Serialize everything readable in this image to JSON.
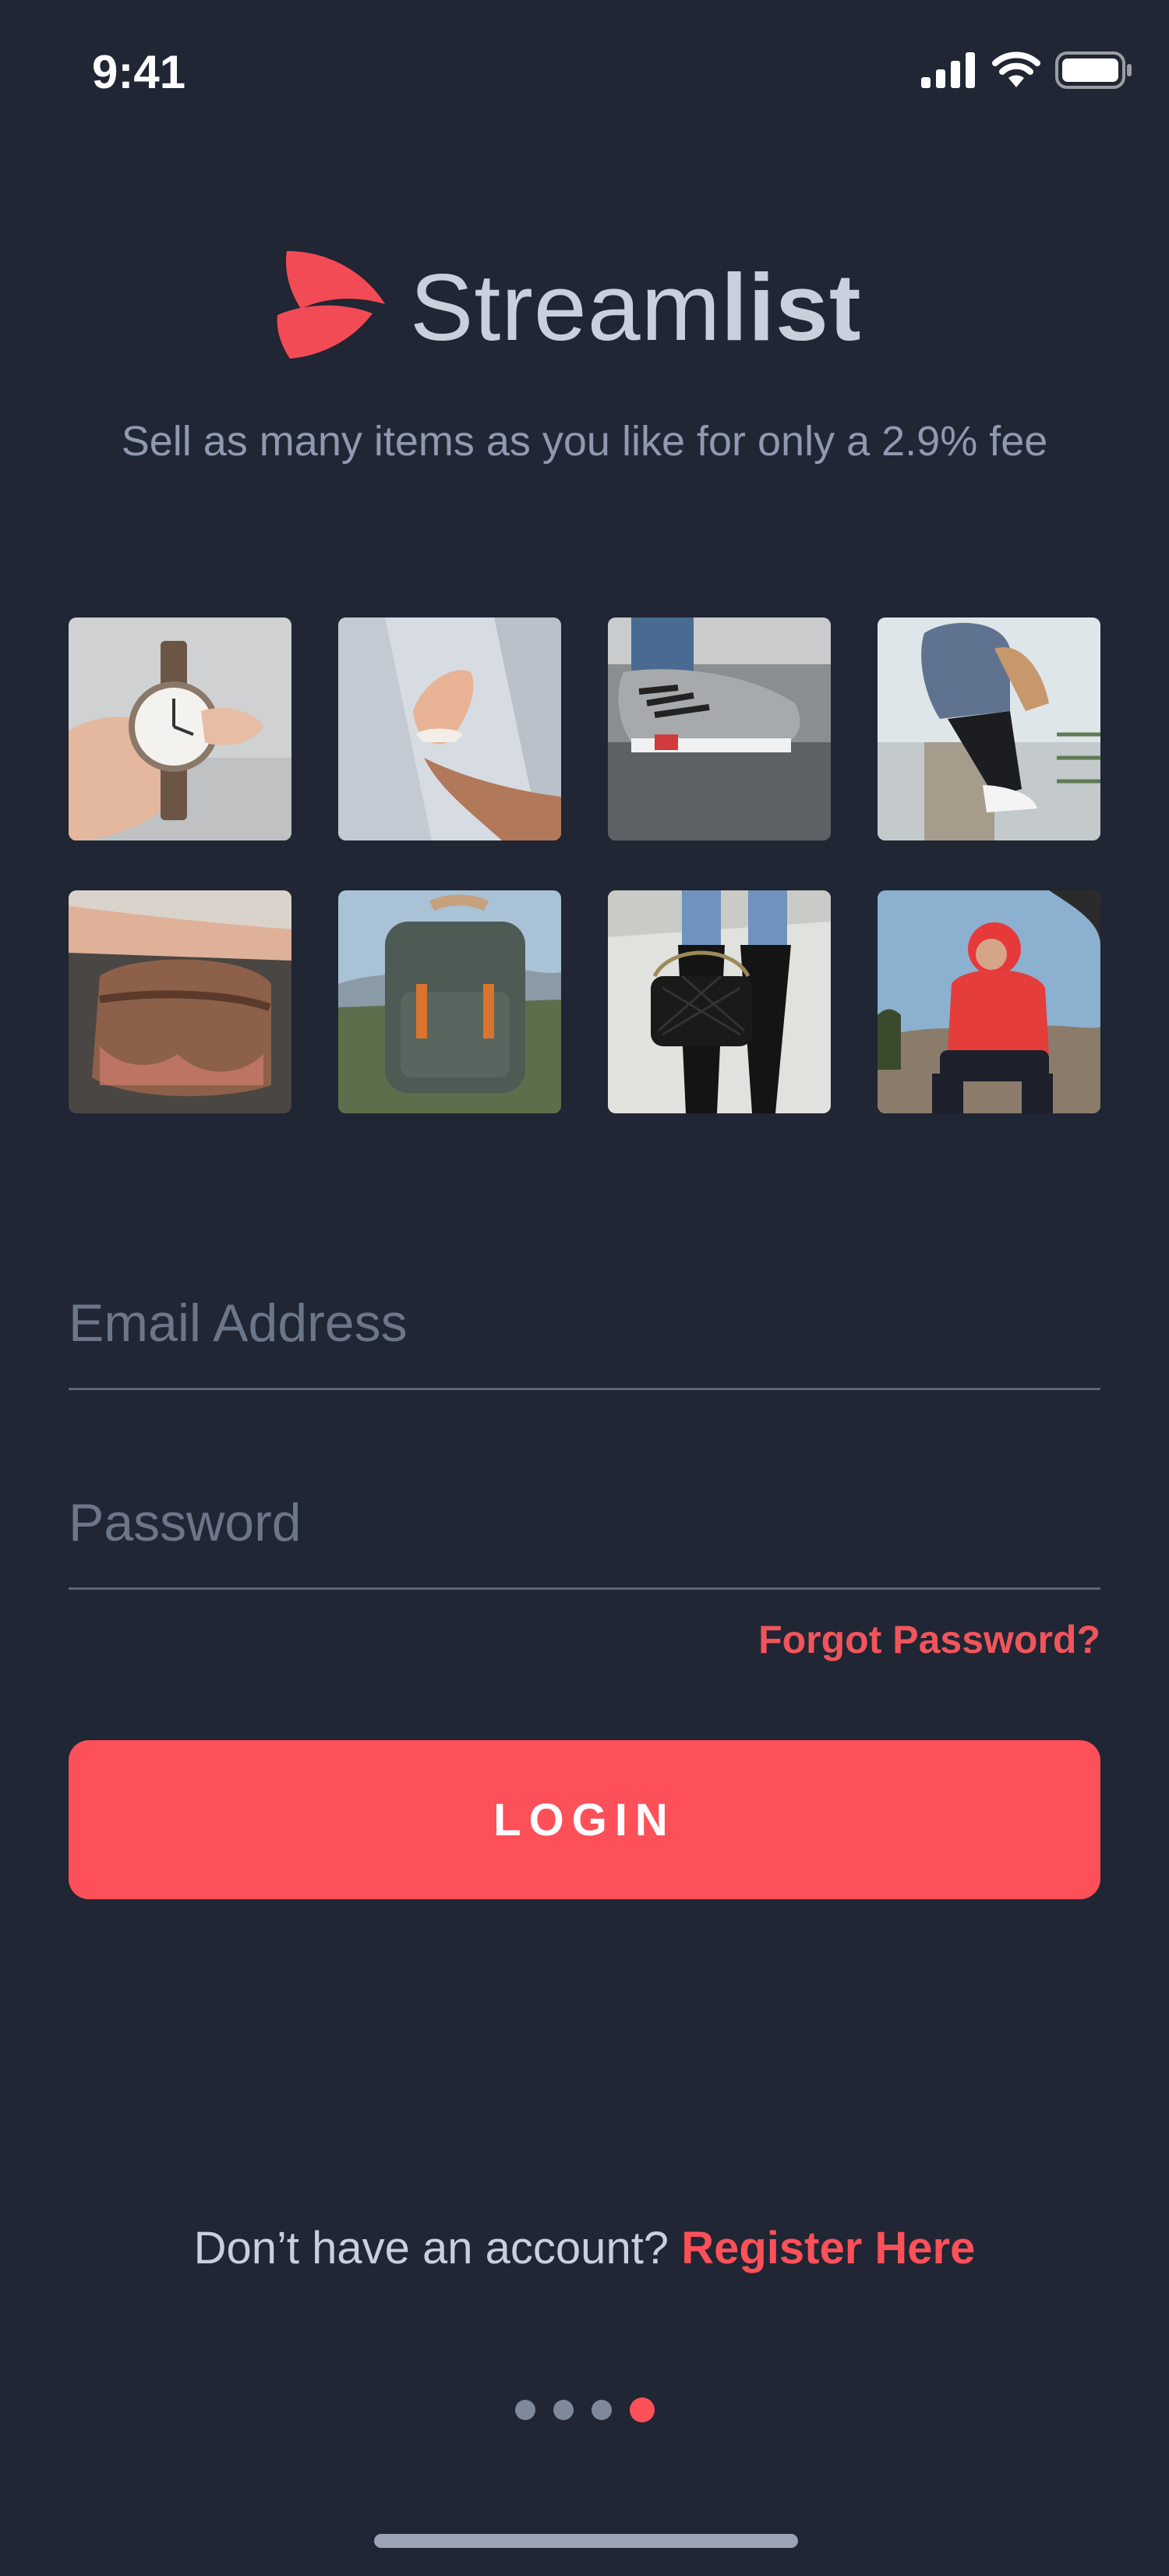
{
  "status_bar": {
    "time": "9:41",
    "icons": [
      "cellular-signal-icon",
      "wifi-icon",
      "battery-icon"
    ]
  },
  "brand": {
    "name_light": "Stream",
    "name_bold": "list",
    "logo_icon": "streamlist-logo-icon",
    "accent_color": "#fd5059"
  },
  "tagline": "Sell as many items as you like for only a 2.9% fee",
  "gallery": {
    "items": [
      {
        "name": "wristwatch-photo"
      },
      {
        "name": "sneaker-hand-photo"
      },
      {
        "name": "grey-sneakers-photo"
      },
      {
        "name": "white-sneakers-photo"
      },
      {
        "name": "leather-bag-photo"
      },
      {
        "name": "backpack-photo"
      },
      {
        "name": "black-handbag-photo"
      },
      {
        "name": "red-hoodie-photo"
      }
    ]
  },
  "form": {
    "email_placeholder": "Email Address",
    "email_value": "",
    "password_placeholder": "Password",
    "password_value": "",
    "forgot_label": "Forgot Password?",
    "login_label": "LOGIN"
  },
  "footer": {
    "register_prompt": "Don’t have an account?",
    "register_link": "Register Here"
  },
  "pagination": {
    "total": 4,
    "active_index": 3
  },
  "colors": {
    "background": "#202633",
    "muted_text": "#8f9ab0",
    "divider": "#5b6577"
  }
}
